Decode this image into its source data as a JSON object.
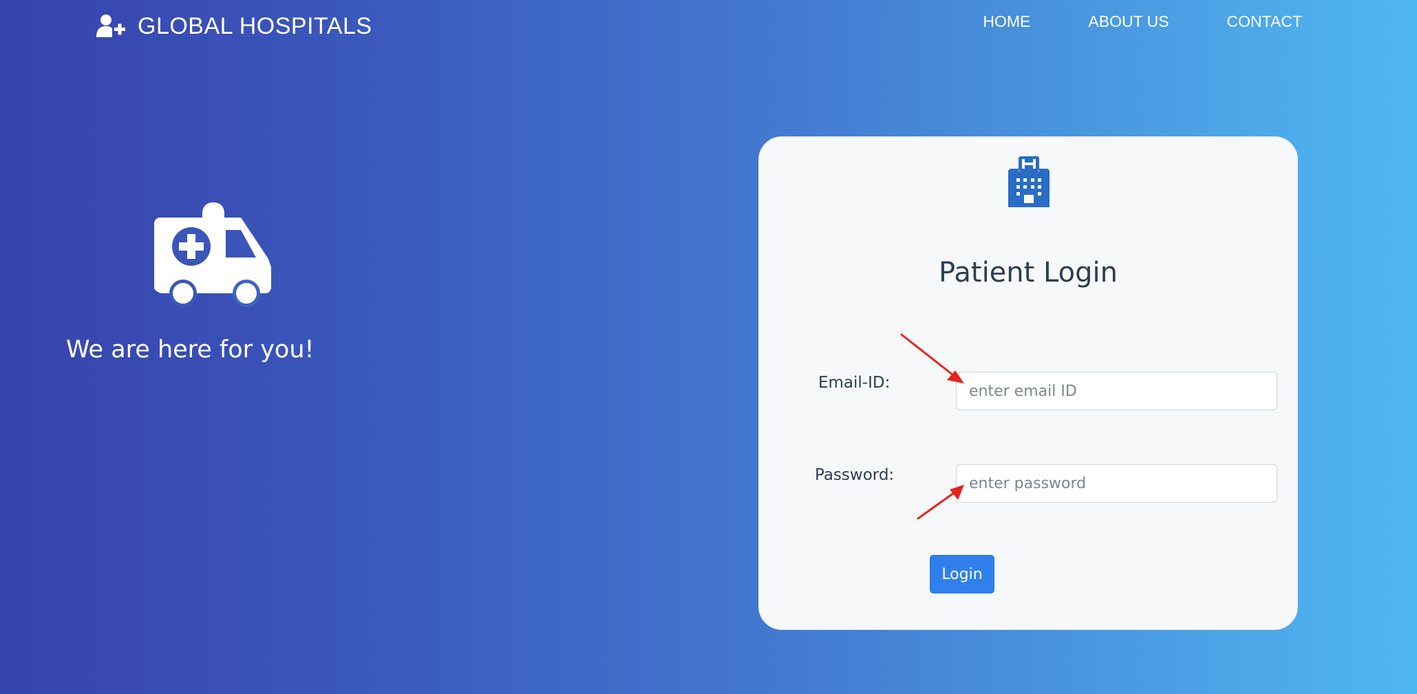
{
  "navbar": {
    "brand_icon": "user-plus-icon",
    "brand_name": "GLOBAL HOSPITALS",
    "links": [
      "HOME",
      "ABOUT US",
      "CONTACT"
    ]
  },
  "hero": {
    "icon": "ambulance-icon",
    "tagline": "We are here for you!"
  },
  "login_card": {
    "icon": "hospital-icon",
    "title": "Patient Login",
    "email": {
      "label": "Email-ID:",
      "placeholder": "enter email ID",
      "value": ""
    },
    "password": {
      "label": "Password:",
      "placeholder": "enter password",
      "value": ""
    },
    "submit_label": "Login"
  },
  "annotations": {
    "arrow_icon": "red-arrow-icon",
    "arrow_color": "#e8231b"
  },
  "colors": {
    "gradient_start": "#3743ac",
    "gradient_end": "#4fb8f2",
    "card_background": "#f7f8fa",
    "icon_blue": "#2a6cc5",
    "button_blue": "#2f80ed",
    "title_text": "#2c3e50"
  }
}
